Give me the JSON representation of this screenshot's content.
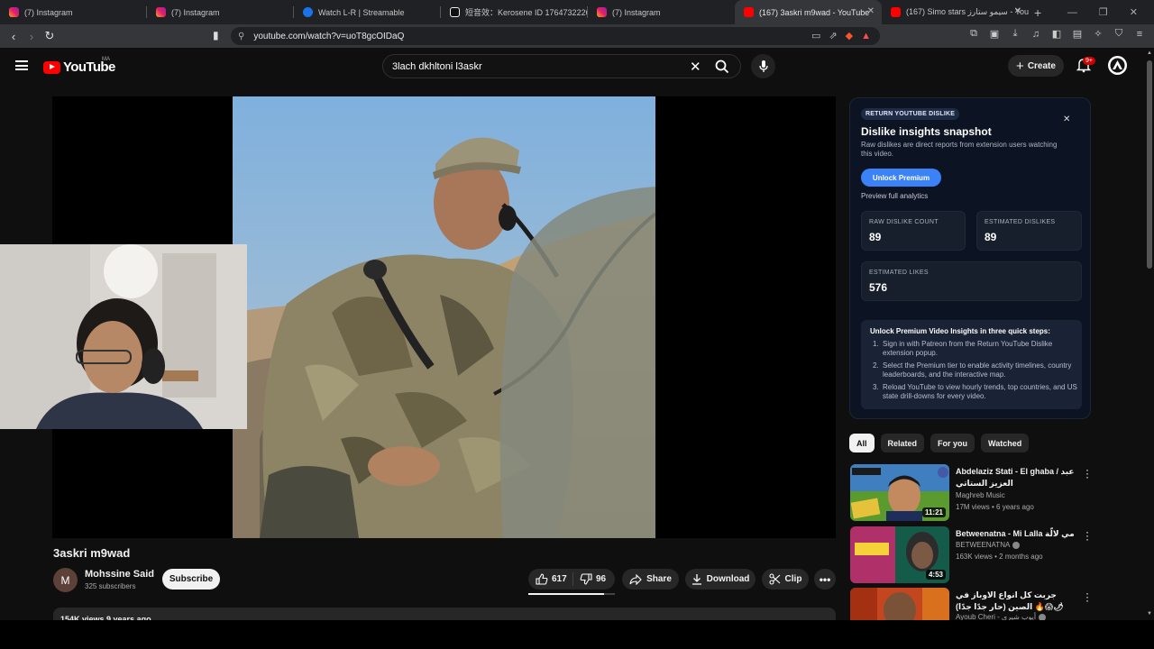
{
  "browser": {
    "tabs": [
      {
        "title": "(7) Instagram",
        "favicon": "instagram-icon"
      },
      {
        "title": "(7) Instagram",
        "favicon": "instagram-icon"
      },
      {
        "title": "Watch L-R | Streamable",
        "favicon": "streamable-icon"
      },
      {
        "title": "短音效：Kerosene ID 1764732226 | ...",
        "favicon": "tiktok-icon"
      },
      {
        "title": "(7) Instagram",
        "favicon": "instagram-icon"
      },
      {
        "title": "(167) 3askri m9wad - YouTube",
        "favicon": "youtube-icon",
        "active": true
      },
      {
        "title": "(167) Simo stars سيمو ستارز - YouTube",
        "favicon": "youtube-icon"
      }
    ],
    "url": "youtube.com/watch?v=uoT8gcOIDaQ"
  },
  "masthead": {
    "logo_text": "YouTube",
    "country_code": "MA",
    "search_value": "3lach dkhltoni l3askr",
    "create_label": "Create",
    "notif_badge": "9+"
  },
  "video": {
    "title": "3askri m9wad",
    "channel": "Mohssine Said",
    "subscribers": "325 subscribers",
    "subscribe_label": "Subscribe",
    "likes": "617",
    "dislikes": "96",
    "like_ratio": 0.87,
    "share_label": "Share",
    "download_label": "Download",
    "clip_label": "Clip",
    "channel_initial": "M",
    "desc_line": "154K views  9 years ago"
  },
  "dislike_panel": {
    "tag": "RETURN YOUTUBE DISLIKE",
    "title": "Dislike insights snapshot",
    "subtitle": "Raw dislikes are direct reports from extension users watching this video.",
    "unlock_label": "Unlock Premium",
    "preview_label": "Preview full analytics",
    "raw_label": "RAW DISLIKE COUNT",
    "raw_value": "89",
    "est_dislikes_label": "ESTIMATED DISLIKES",
    "est_dislikes_value": "89",
    "est_likes_label": "ESTIMATED LIKES",
    "est_likes_value": "576",
    "steps_heading": "Unlock Premium Video Insights in three quick steps:",
    "steps": [
      "Sign in with Patreon from the Return YouTube Dislike extension popup.",
      "Select the Premium tier to enable activity timelines, country leaderboards, and the interactive map.",
      "Reload YouTube to view hourly trends, top countries, and US state drill-downs for every video."
    ]
  },
  "chips": [
    "All",
    "Related",
    "For you",
    "Watched"
  ],
  "recommendations": [
    {
      "title": "Abdelaziz Stati - El ghaba / عبد العزيز الستاتي",
      "channel": "Maghreb Music",
      "meta": "17M views • 6 years ago",
      "duration": "11:21"
    },
    {
      "title": "Betweenatna - Mi Lalla مي لالّة",
      "channel": "BETWEENATNA",
      "meta": "163K views • 2 months ago",
      "duration": "4:53"
    },
    {
      "title": "جربت كل انواع الاوباز في الصين (حار جدًا جدًا) 🔥😱🌶",
      "channel": "Ayoub Cheri - أيوب شيري",
      "meta": "",
      "duration": ""
    }
  ]
}
